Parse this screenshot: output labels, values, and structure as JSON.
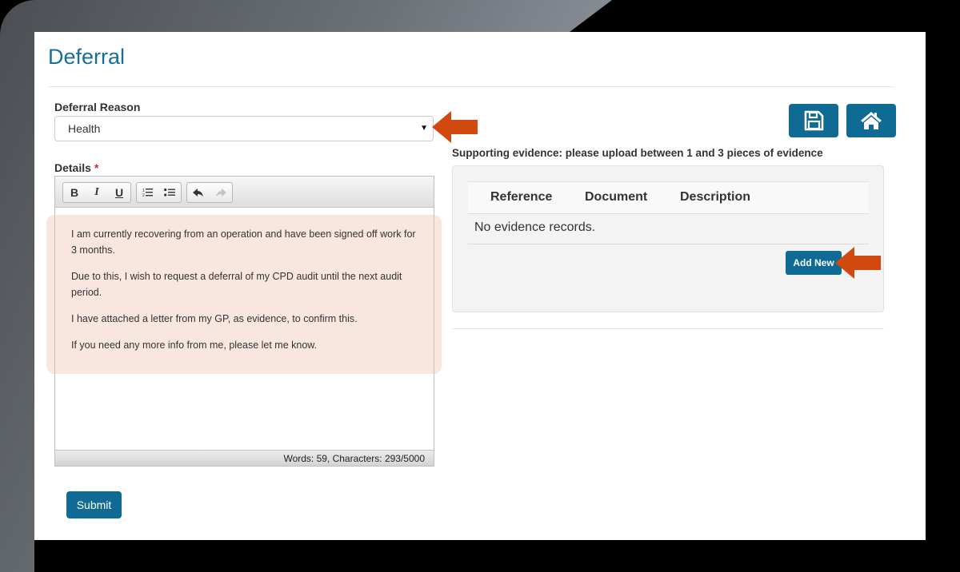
{
  "page": {
    "title": "Deferral"
  },
  "form": {
    "reason_label": "Deferral Reason",
    "reason_value": "Health",
    "details_label": "Details",
    "required_marker": "*",
    "toolbar": {
      "bold": "B",
      "italic": "I",
      "underline": "U",
      "undo_icon": "undo-icon",
      "redo_icon": "redo-icon"
    },
    "details_paragraphs": [
      "I am currently recovering from an operation and have been signed off work for 3 months.",
      "Due to this, I wish to request a deferral of my CPD audit until the next audit period.",
      "I have attached a letter from my GP, as evidence, to confirm this.",
      "If you need any more info from me, please let me know."
    ],
    "word_count_status": "Words: 59, Characters: 293/5000",
    "submit_label": "Submit"
  },
  "actions": {
    "save_icon": "save-icon",
    "home_icon": "home-icon"
  },
  "evidence": {
    "heading": "Supporting evidence: please upload between 1 and 3 pieces of evidence",
    "columns": [
      "Reference",
      "Document",
      "Description"
    ],
    "empty_message": "No evidence records.",
    "add_new_label": "Add New"
  },
  "annotations": {
    "arrow_color": "#d2490f"
  },
  "colors": {
    "primary": "#0f6a94",
    "title": "#1a6e9a"
  }
}
